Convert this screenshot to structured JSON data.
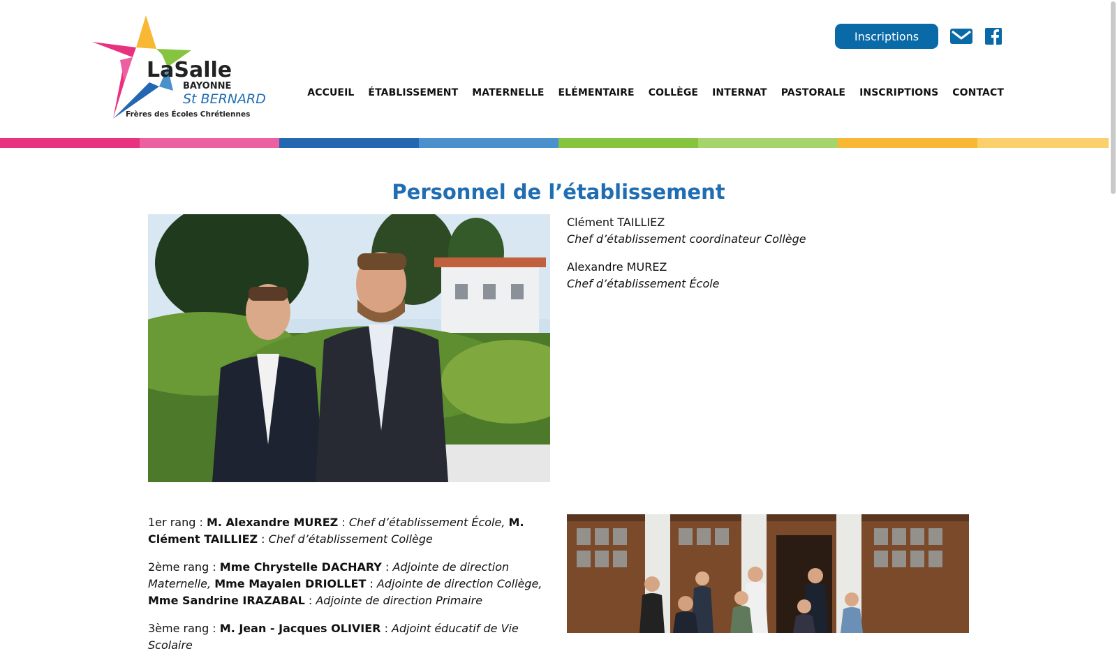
{
  "header": {
    "logo": {
      "name": "LaSalle",
      "city": "BAYONNE",
      "school": "St BERNARD",
      "tagline": "Frères des Écoles Chrétiennes"
    },
    "inscriptions_button": "Inscriptions",
    "mail_icon": "mail-icon",
    "facebook_icon": "facebook-icon",
    "nav": [
      "ACCUEIL",
      "ÉTABLISSEMENT",
      "MATERNELLE",
      "ELÉMENTAIRE",
      "COLLÈGE",
      "INTERNAT",
      "PASTORALE",
      "INSCRIPTIONS",
      "CONTACT"
    ]
  },
  "stripe_colors": [
    "#e8317f",
    "#ec5fa0",
    "#2366b1",
    "#4b8fcc",
    "#86c440",
    "#a7d36b",
    "#f8b833",
    "#fbcf6b"
  ],
  "page": {
    "title": "Personnel de l’établissement",
    "directors": [
      {
        "name": "Clément TAILLIEZ",
        "role": "Chef d’établissement coordinateur Collège"
      },
      {
        "name": "Alexandre MUREZ",
        "role": "Chef d’établissement École"
      }
    ],
    "rangs": [
      {
        "prefix": "1er rang : ",
        "items": [
          {
            "name": "M. Alexandre MUREZ",
            "sep": " : ",
            "role": "Chef d’établissement École,",
            "after": " "
          },
          {
            "name": "M. Clément TAILLIEZ",
            "sep": " : ",
            "role": "Chef d’établissement Collège",
            "after": ""
          }
        ]
      },
      {
        "prefix": "2ème rang : ",
        "items": [
          {
            "name": "Mme Chrystelle DACHARY",
            "sep": " : ",
            "role": "Adjointe de direction Maternelle,",
            "after": " "
          },
          {
            "name": "Mme Mayalen DRIOLLET",
            "sep": " : ",
            "role": "Adjointe de direction Collège,",
            "after": " "
          },
          {
            "name": "Mme Sandrine IRAZABAL",
            "sep": " : ",
            "role": "Adjointe de direction Primaire",
            "after": ""
          }
        ]
      },
      {
        "prefix": "3ème rang : ",
        "items": [
          {
            "name": "M. Jean - Jacques OLIVIER",
            "sep": " : ",
            "role": "Adjoint éducatif de Vie Scolaire",
            "after": ""
          }
        ]
      }
    ]
  }
}
